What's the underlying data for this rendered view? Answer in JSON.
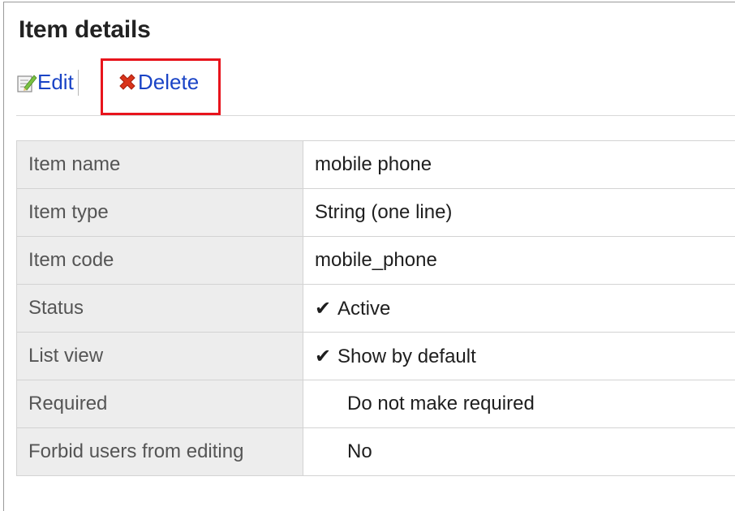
{
  "panel": {
    "title": "Item details"
  },
  "toolbar": {
    "edit_label": "Edit",
    "delete_label": "Delete"
  },
  "details": [
    {
      "label": "Item name",
      "value": "mobile phone",
      "check": ""
    },
    {
      "label": "Item type",
      "value": "String (one line)",
      "check": ""
    },
    {
      "label": "Item code",
      "value": "mobile_phone",
      "check": ""
    },
    {
      "label": "Status",
      "value": "Active",
      "check": "✔"
    },
    {
      "label": "List view",
      "value": "Show by default",
      "check": "✔"
    },
    {
      "label": "Required",
      "value": "Do not make required",
      "check": ""
    },
    {
      "label": "Forbid users from editing",
      "value": "No",
      "check": ""
    }
  ],
  "colors": {
    "link": "#1a44c6",
    "highlight": "#e8141c",
    "label_bg": "#ededed"
  },
  "icons": {
    "edit": "edit-icon",
    "delete": "delete-icon",
    "check": "checkmark-icon"
  }
}
